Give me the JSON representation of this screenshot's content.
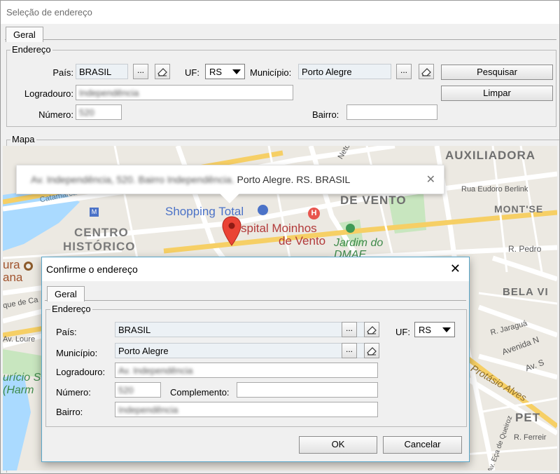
{
  "window": {
    "title": "Seleção de endereço"
  },
  "tabs": {
    "geral": "Geral"
  },
  "endereco": {
    "legend": "Endereço",
    "pais_label": "País:",
    "pais_value": "BRASIL",
    "uf_label": "UF:",
    "uf_value": "RS",
    "municipio_label": "Município:",
    "municipio_value": "Porto Alegre",
    "logradouro_label": "Logradouro:",
    "logradouro_value": "Independência",
    "numero_label": "Número:",
    "numero_value": "520",
    "bairro_label": "Bairro:",
    "bairro_value": "",
    "ellipsis": "...",
    "pesquisar_label": "Pesquisar",
    "limpar_label": "Limpar"
  },
  "mapa": {
    "legend": "Mapa",
    "popup_blurred": "Av. Independência, 520. Bairro Independência.",
    "popup_text": "Porto Alegre. RS. BRASIL",
    "close_glyph": "✕",
    "labels": {
      "auxiliadora": "AUXILIADORA",
      "rua_eudoro": "Rua Eudoro Berlink",
      "de_vento": "DE VENTO",
      "mont_se": "MONT'SE",
      "shopping": "Shopping Total",
      "hospital": "spital Moinhos",
      "hospital2": "de Vento",
      "jardim": "Jardim do",
      "dmae": "DMAE",
      "centro": "CENTRO",
      "historico": "HISTÓRICO",
      "catamarca": "Catamarca Caruso",
      "neto": "Neto",
      "r_pedro": "R. Pedro",
      "bela_vi": "BELA VI",
      "r_jaragua": "R. Jaraguá",
      "avenida_n": "Avenida N",
      "av_s": "Av. S",
      "protasio": "Protásio Alves",
      "pet": "PET",
      "r_ferreir": "R. Ferreir",
      "ura": "ura",
      "ana": "ana",
      "que_de_ca": "que de Ca",
      "av_loure": "Av. Loure",
      "uricio": "urício S",
      "harm": "(Harm",
      "queiroz": "Av. Eça de Queiroz"
    }
  },
  "dialog": {
    "title": "Confirme o endereço",
    "close_glyph": "✕",
    "tab": "Geral",
    "legend": "Endereço",
    "pais_label": "País:",
    "pais_value": "BRASIL",
    "uf_label": "UF:",
    "uf_value": "RS",
    "municipio_label": "Município:",
    "municipio_value": "Porto Alegre",
    "logradouro_label": "Logradouro:",
    "logradouro_value": "Av. Independência",
    "numero_label": "Número:",
    "numero_value": "520",
    "complemento_label": "Complemento:",
    "complemento_value": "",
    "bairro_label": "Bairro:",
    "bairro_value": "Independência",
    "ellipsis": "...",
    "ok_label": "OK",
    "cancelar_label": "Cancelar"
  },
  "colors": {
    "map_bg": "#e8e5df",
    "water": "#aadaff",
    "park": "#c8e6bf",
    "pin": "#ea4335",
    "dialog_border": "#5aa7c9"
  },
  "icons": {
    "ellipsis": "ellipsis-button",
    "eraser": "eraser-icon",
    "combo_arrow": "chevron-down-icon",
    "pin": "map-pin-icon",
    "close": "close-icon"
  }
}
